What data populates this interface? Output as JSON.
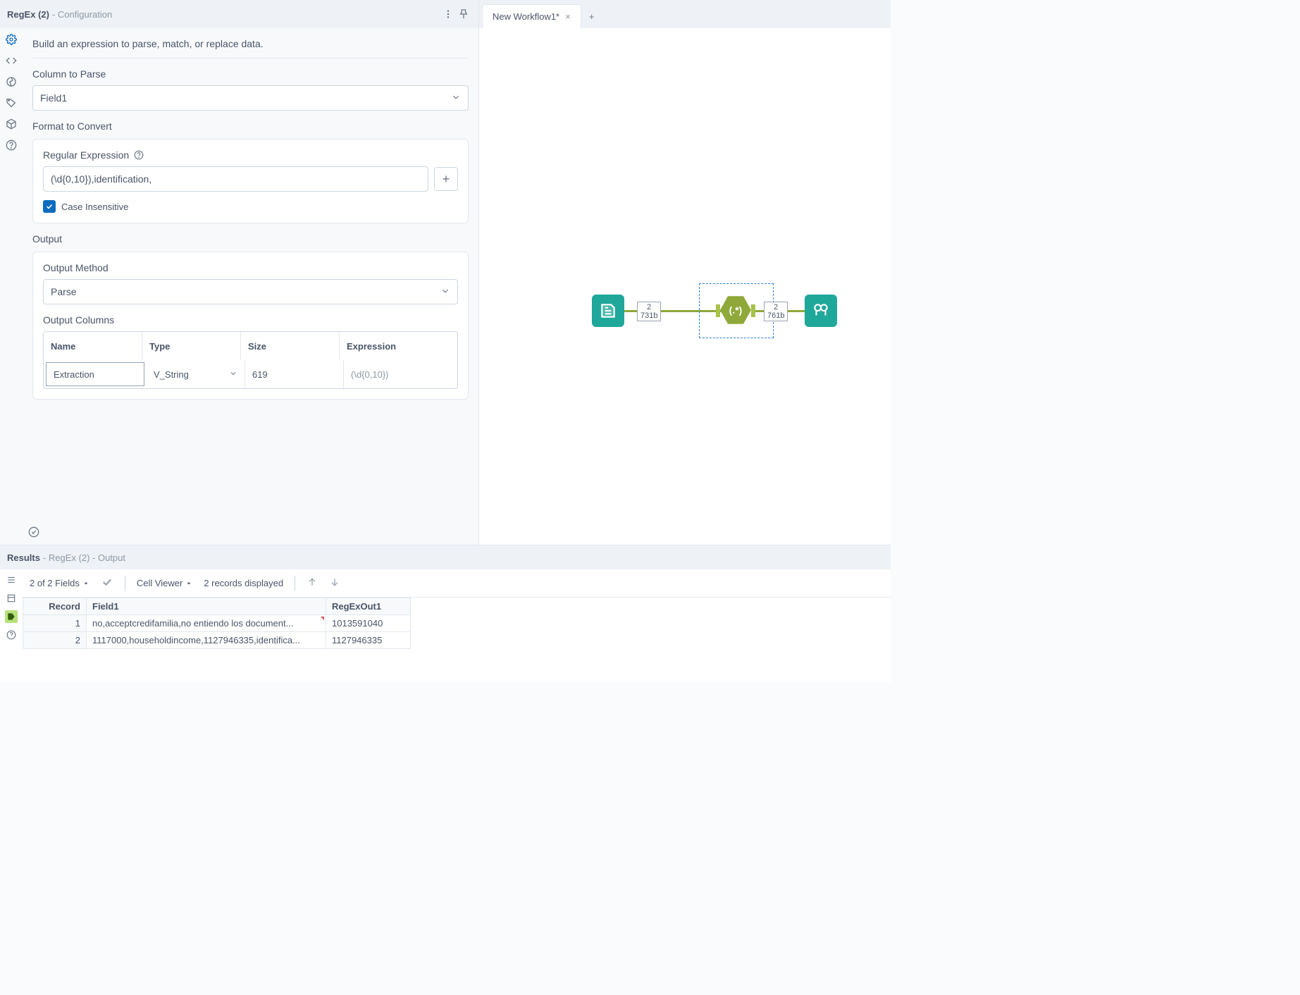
{
  "config": {
    "title": "RegEx (2)",
    "subtitle": " - Configuration",
    "intro": "Build an expression to parse, match, or replace data.",
    "column_to_parse_label": "Column to Parse",
    "column_to_parse_value": "Field1",
    "format_to_convert_label": "Format to Convert",
    "regex_label": "Regular Expression",
    "regex_value": "(\\d{0,10}),identification,",
    "case_insensitive_label": "Case Insensitive",
    "case_insensitive_checked": true,
    "output_label": "Output",
    "output_method_label": "Output Method",
    "output_method_value": "Parse",
    "output_columns_label": "Output Columns",
    "output_columns": {
      "headers": {
        "name": "Name",
        "type": "Type",
        "size": "Size",
        "expression": "Expression"
      },
      "row": {
        "name": "Extraction",
        "type": "V_String",
        "size": "619",
        "expression": "(\\d{0,10})"
      }
    }
  },
  "canvas": {
    "tab_label": "New Workflow1*",
    "badge1_top": "2",
    "badge1_bottom": "731b",
    "badge2_top": "2",
    "badge2_bottom": "761b",
    "regex_text": "(.*)"
  },
  "results": {
    "title": "Results",
    "subtitle": " - RegEx (2) - Output",
    "fields_text": "2 of 2 Fields",
    "cell_viewer_text": "Cell Viewer",
    "records_text": "2 records displayed",
    "headers": {
      "record": "Record",
      "field1": "Field1",
      "regexout": "RegExOut1"
    },
    "rows": [
      {
        "n": "1",
        "field1": "no,acceptcredifamilia,no entiendo los document...",
        "regexout": "1013591040"
      },
      {
        "n": "2",
        "field1": "1117000,householdincome,1127946335,identifica...",
        "regexout": "1127946335"
      }
    ]
  }
}
